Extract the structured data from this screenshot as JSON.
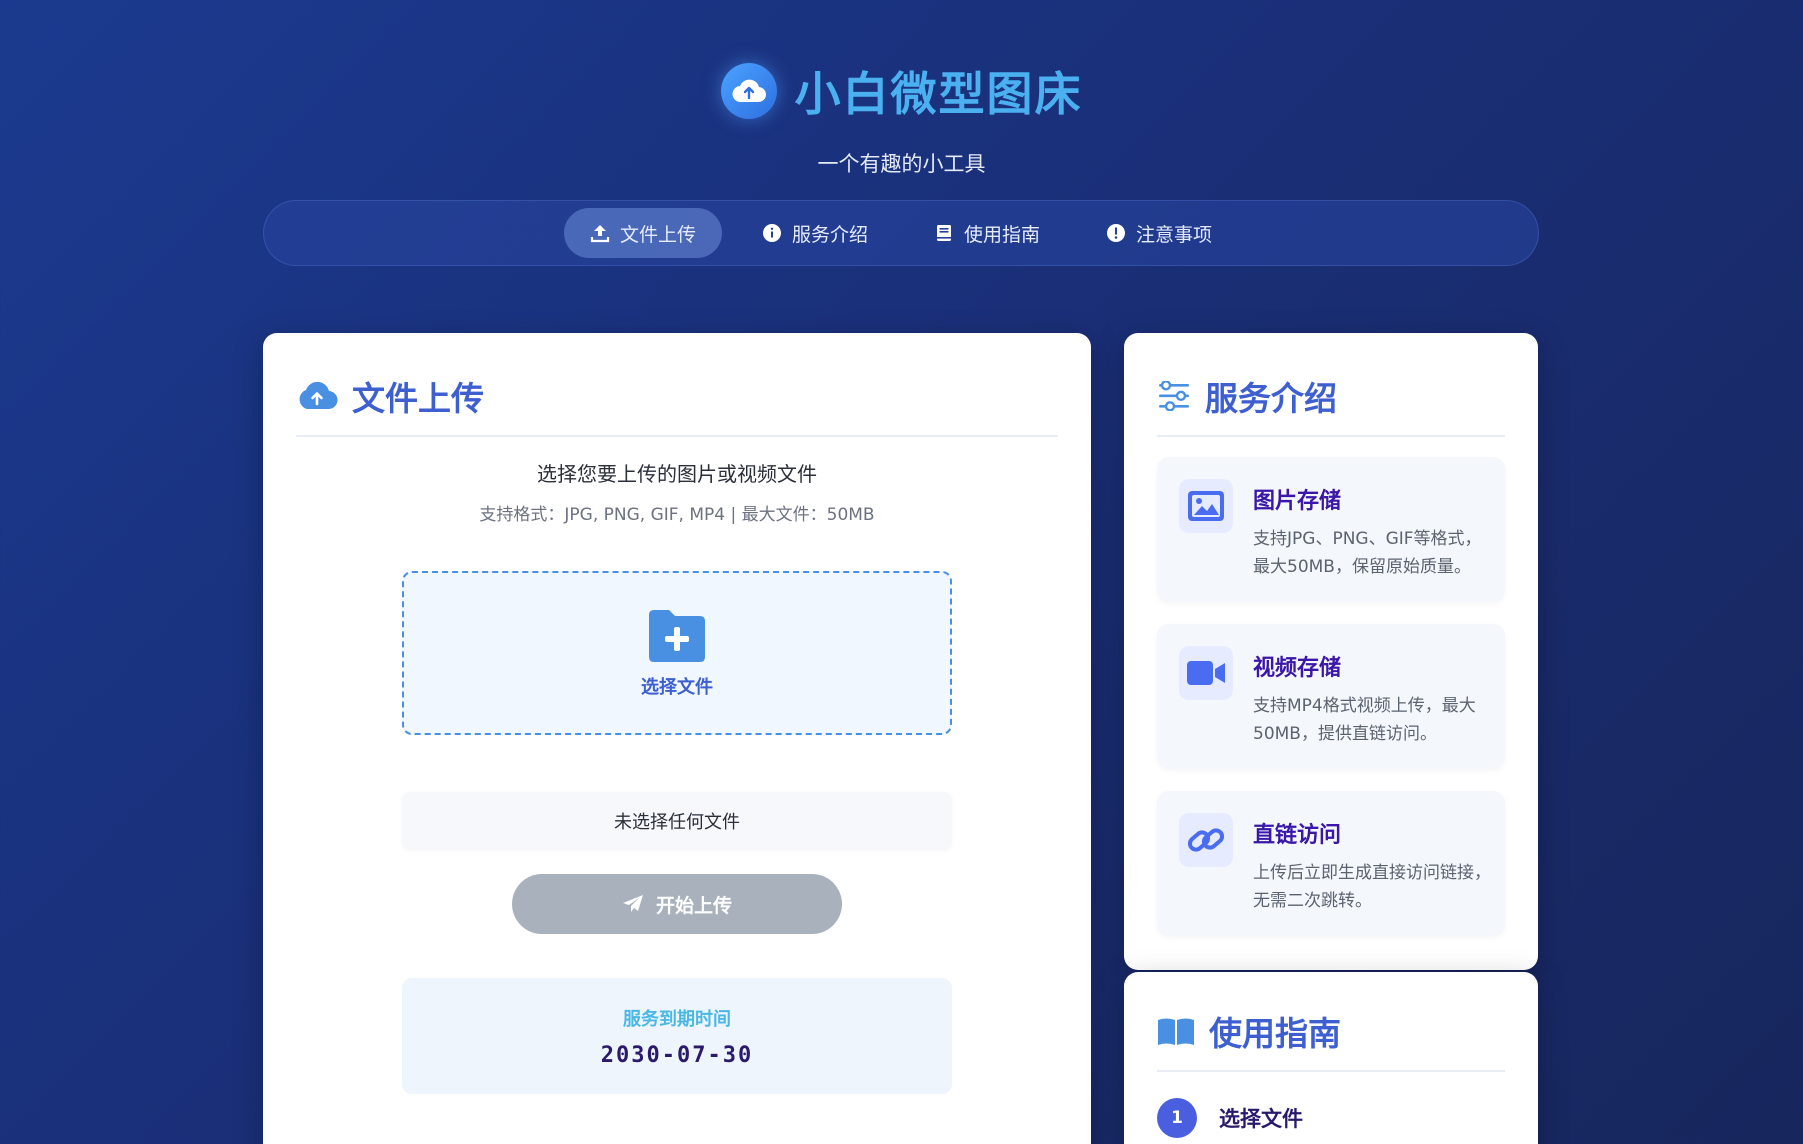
{
  "header": {
    "title": "小白微型图床",
    "subtitle": "一个有趣的小工具",
    "logo_icon": "cloud-upload-icon"
  },
  "nav": {
    "items": [
      {
        "label": "文件上传",
        "icon": "upload-icon",
        "active": true
      },
      {
        "label": "服务介绍",
        "icon": "info-icon",
        "active": false
      },
      {
        "label": "使用指南",
        "icon": "book-icon",
        "active": false
      },
      {
        "label": "注意事项",
        "icon": "exclamation-icon",
        "active": false
      }
    ]
  },
  "upload": {
    "title": "文件上传",
    "description": "选择您要上传的图片或视频文件",
    "formats": "支持格式：JPG, PNG, GIF, MP4 | 最大文件：50MB",
    "dropzone_label": "选择文件",
    "file_status": "未选择任何文件",
    "upload_button": "开始上传",
    "expire_label": "服务到期时间",
    "expire_date": "2030-07-30"
  },
  "services": {
    "title": "服务介绍",
    "items": [
      {
        "title": "图片存储",
        "desc": "支持JPG、PNG、GIF等格式，最大50MB，保留原始质量。",
        "icon": "image-icon"
      },
      {
        "title": "视频存储",
        "desc": "支持MP4格式视频上传，最大50MB，提供直链访问。",
        "icon": "video-icon"
      },
      {
        "title": "直链访问",
        "desc": "上传后立即生成直接访问链接，无需二次跳转。",
        "icon": "link-icon"
      }
    ]
  },
  "guide": {
    "title": "使用指南",
    "steps": [
      {
        "num": "1",
        "title": "选择文件"
      }
    ]
  },
  "colors": {
    "accent": "#3d5fd0",
    "title_cyan": "#4ab0f0",
    "service_title": "#3a17a8",
    "button_disabled": "#a9b1bd"
  }
}
